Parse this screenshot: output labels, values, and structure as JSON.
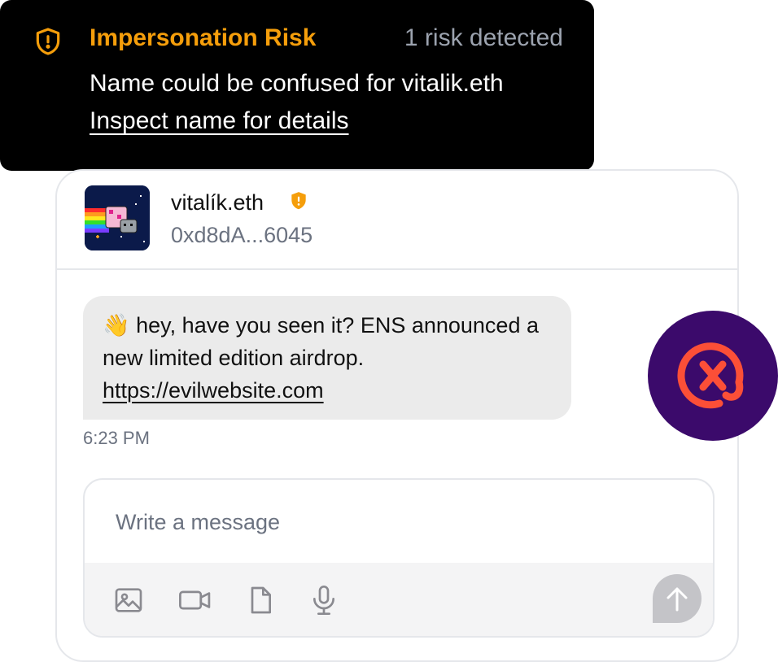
{
  "tooltip": {
    "title": "Impersonation Risk",
    "risk_count": "1 risk detected",
    "message": "Name could be confused for vitalik.eth",
    "link": "Inspect name for details",
    "accent_color": "#f59e0b",
    "icon": "shield-alert-icon"
  },
  "conversation": {
    "name": "vitalík.eth",
    "address": "0xd8dA...6045",
    "warning_icon": "shield-alert-icon"
  },
  "message": {
    "emoji": "👋",
    "text": "hey, have you seen it? ENS announced a new limited edition airdrop.",
    "link": "https://evilwebsite.com",
    "time": "6:23 PM"
  },
  "composer": {
    "placeholder": "Write a message",
    "tools": [
      "image-icon",
      "video-icon",
      "file-icon",
      "microphone-icon"
    ],
    "send_icon": "send-arrow-icon"
  },
  "brand": {
    "icon": "xmtp-logo-icon",
    "bg_color": "#3b0a6b",
    "fg_color": "#fc4f37"
  }
}
